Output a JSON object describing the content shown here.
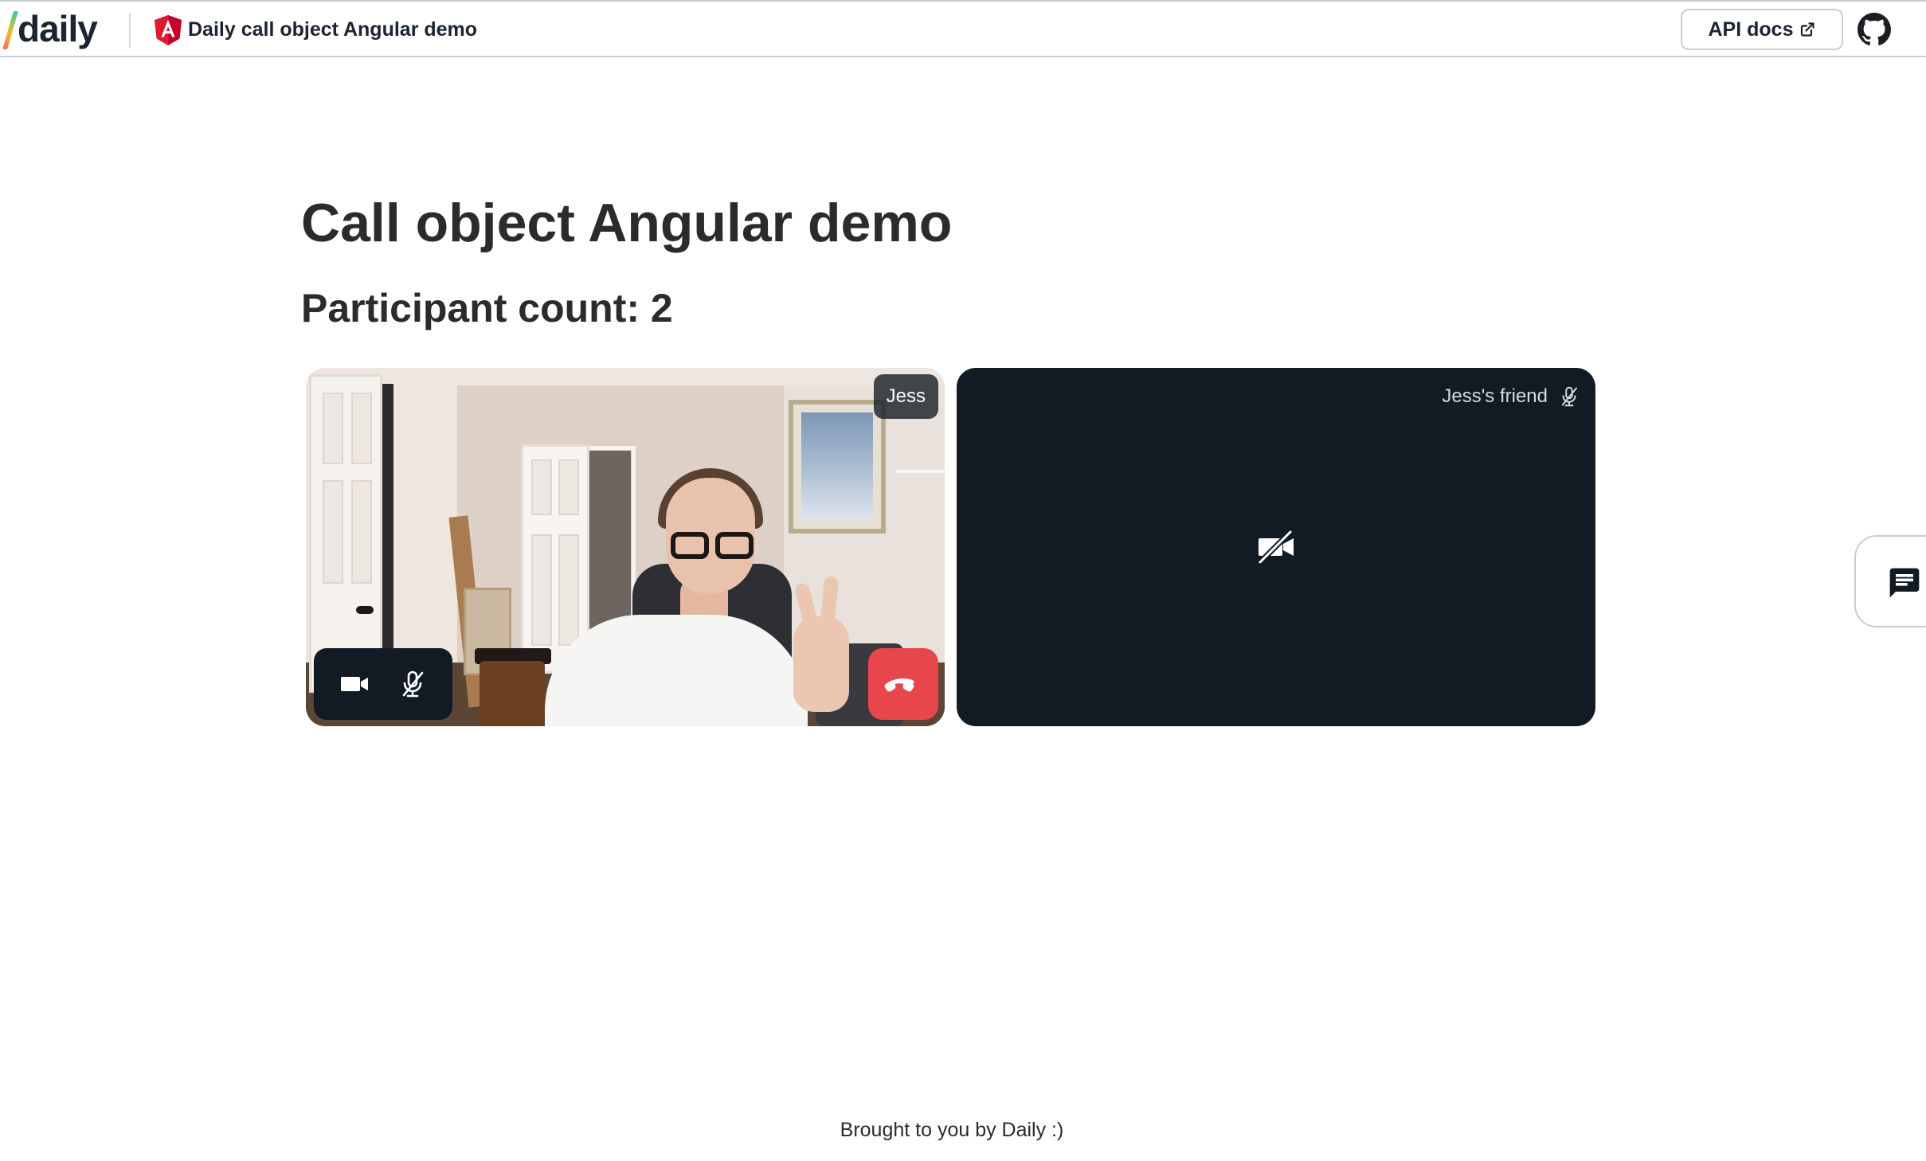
{
  "header": {
    "logo_text": "daily",
    "title": "Daily call object Angular demo",
    "api_docs_label": "API docs",
    "icons": {
      "angular": "angular-logo-icon",
      "external_link": "external-link-icon",
      "github": "github-icon"
    }
  },
  "main": {
    "title": "Call object Angular demo",
    "participant_count": "Participant count: 2"
  },
  "tiles": [
    {
      "participant_name": "Jess",
      "is_local": true,
      "video_on": true,
      "controls": {
        "camera_icon": "video-camera-icon",
        "mic_icon": "mic-off-icon",
        "leave_icon": "hang-up-icon"
      }
    },
    {
      "participant_name": "Jess's friend",
      "is_local": false,
      "video_on": false,
      "mic_icon": "mic-off-icon",
      "placeholder_icon": "video-off-icon"
    }
  ],
  "chat": {
    "icon": "chat-icon"
  },
  "footer": {
    "text": "Brought to you by Daily :)"
  },
  "colors": {
    "tile_background": "#121a24",
    "hangup": "#e8464d",
    "text": "#2b2b2b",
    "border": "#c9cdd3"
  }
}
